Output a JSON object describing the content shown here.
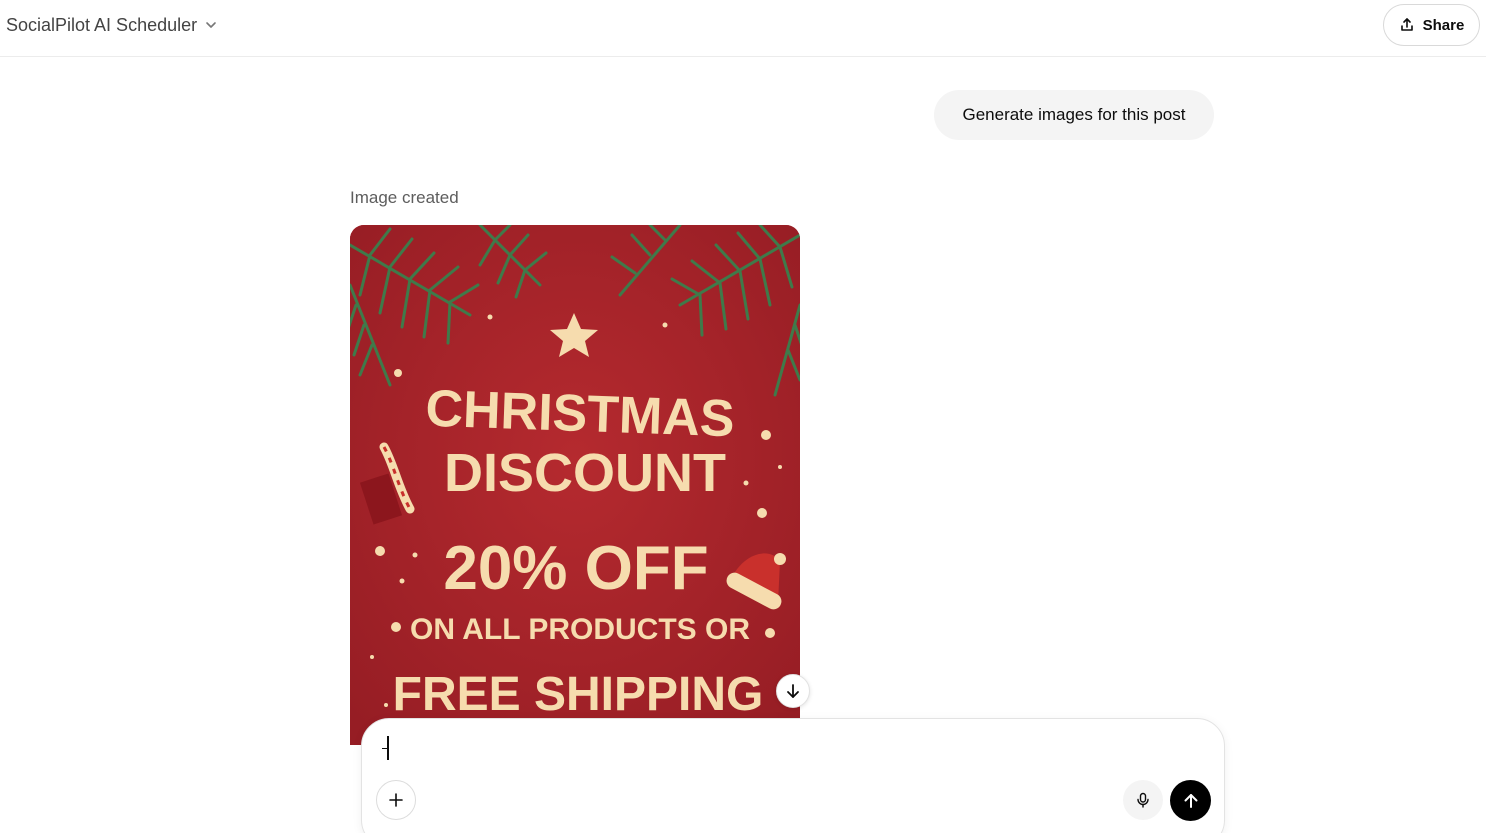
{
  "header": {
    "title": "SocialPilot AI Scheduler",
    "share_label": "Share"
  },
  "conversation": {
    "user_message": "Generate images for this post",
    "image_caption": "Image created",
    "generated_image": {
      "lines": [
        "CHRISTMAS",
        "DISCOUNT",
        "20% OFF",
        "ON ALL PRODUCTS OR",
        "FREE SHIPPING"
      ],
      "colors": {
        "background": "#a8232a",
        "text": "#f6dcae",
        "pine": "#3f7a4a",
        "santa_hat": "#c9302c"
      }
    }
  },
  "composer": {
    "value": "",
    "placeholder": ""
  },
  "icons": {
    "model_menu": "chevron-down-icon",
    "share": "share-upload-icon",
    "scroll": "arrow-down-icon",
    "attach": "plus-icon",
    "voice": "microphone-icon",
    "send": "arrow-up-icon"
  }
}
